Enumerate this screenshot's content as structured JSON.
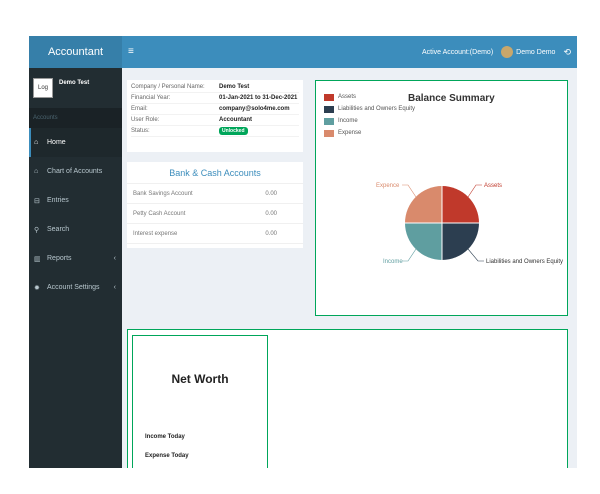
{
  "app": {
    "title": "Accountant"
  },
  "topbar": {
    "menu_icon": "hamburger-icon",
    "active_account": "Active Account:(Demo)",
    "user": "Demo Demo",
    "signout_icon": "signout-icon"
  },
  "sidebar": {
    "avatar_text": "Log",
    "user_name": "Demo Test",
    "section_header": "Accounts",
    "items": [
      {
        "label": "Home",
        "icon": "home-icon",
        "active": true
      },
      {
        "label": "Chart of Accounts",
        "icon": "bank-icon"
      },
      {
        "label": "Entries",
        "icon": "entries-icon"
      },
      {
        "label": "Search",
        "icon": "search-icon"
      },
      {
        "label": "Reports",
        "icon": "bar-chart-icon",
        "arrow": "‹"
      },
      {
        "label": "Account Settings",
        "icon": "gear-icon",
        "arrow": "‹"
      }
    ]
  },
  "company_info": [
    {
      "label": "Company / Personal Name:",
      "value": "Demo Test"
    },
    {
      "label": "Financial Year:",
      "value": "01-Jan-2021 to 31-Dec-2021"
    },
    {
      "label": "Email:",
      "value": "company@solo4me.com"
    },
    {
      "label": "User Role:",
      "value": "Accountant"
    },
    {
      "label": "Status:",
      "value": "Unlocked",
      "badge": true
    }
  ],
  "bank": {
    "title": "Bank & Cash Accounts",
    "rows": [
      {
        "name": "Bank Savings Account",
        "amount": "0.00"
      },
      {
        "name": "Petty Cash Account",
        "amount": "0.00"
      },
      {
        "name": "Interest expense",
        "amount": "0.00"
      }
    ]
  },
  "balance": {
    "title": "Balance Summary",
    "legend": [
      {
        "label": "Assets",
        "color": "#c0392b"
      },
      {
        "label": "Liabilities and Owners Equity",
        "color": "#2c3e50"
      },
      {
        "label": "Income",
        "color": "#5f9ea0"
      },
      {
        "label": "Expense",
        "color": "#d98a6c"
      }
    ],
    "slice_labels": [
      "Assets",
      "Liabilities and Owners Equity",
      "Income",
      "Expence"
    ]
  },
  "networth": {
    "title": "Net Worth",
    "income_label": "Income Today",
    "expense_label": "Expense Today"
  }
}
